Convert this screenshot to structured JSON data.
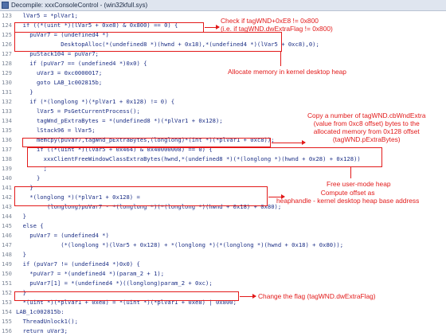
{
  "window": {
    "title": "Decompile: xxxConsoleControl - (win32kfull.sys)"
  },
  "code_lines": [
    {
      "n": "123",
      "text": "  lVar5 = *plVar1;"
    },
    {
      "n": "124",
      "text": "  if ((*(uint *)(lVar5 + 0xe8) & 0x800) == 0) {"
    },
    {
      "n": "125",
      "text": "    puVar7 = (undefined4 *)"
    },
    {
      "n": "126",
      "text": "             DesktopAlloc(*(undefined8 *)(hwnd + 0x18),*(undefined4 *)(lVar5 + 0xc8),0);"
    },
    {
      "n": "127",
      "text": "    puStack104 = puVar7;"
    },
    {
      "n": "128",
      "text": "    if (puVar7 == (undefined4 *)0x0) {"
    },
    {
      "n": "129",
      "text": "      uVar3 = 0xc0000017;"
    },
    {
      "n": "130",
      "text": "      goto LAB_1c002815b;"
    },
    {
      "n": "131",
      "text": "    }"
    },
    {
      "n": "132",
      "text": "    if (*(longlong *)(*plVar1 + 0x128) != 0) {"
    },
    {
      "n": "133",
      "text": "      lVar5 = PsGetCurrentProcess();"
    },
    {
      "n": "134",
      "text": "      tagWnd_pExtraBytes = *(undefined8 *)(*plVar1 + 0x128);"
    },
    {
      "n": "135",
      "text": "      lStack96 = lVar5;"
    },
    {
      "n": "136",
      "text": "      memcpy(puVar7,tagWnd_pExtraBytes,(longlong)*(int *)(*plVar1 + 0xc8));"
    },
    {
      "n": "137",
      "text": "      if ((*(uint *)(lVar5 + 0x464) & 0x40000008) == 0) {"
    },
    {
      "n": "138",
      "text": "        xxxClientFreeWindowClassExtraBytes(hwnd,*(undefined8 *)(*(longlong *)(hwnd + 0x28) + 0x128))"
    },
    {
      "n": "139",
      "text": "        ;"
    },
    {
      "n": "140",
      "text": "      }"
    },
    {
      "n": "141",
      "text": "    }"
    },
    {
      "n": "142",
      "text": "    *(longlong *)(*plVar1 + 0x128) ="
    },
    {
      "n": "143",
      "text": "         (longlong)puVar7 - *(longlong *)(*(longlong *)(hwnd + 0x18) + 0x80);"
    },
    {
      "n": "144",
      "text": "  }"
    },
    {
      "n": "145",
      "text": "  else {"
    },
    {
      "n": "146",
      "text": "    puVar7 = (undefined4 *)"
    },
    {
      "n": "147",
      "text": "             (*(longlong *)(lVar5 + 0x128) + *(longlong *)(*(longlong *)(hwnd + 0x18) + 0x80));"
    },
    {
      "n": "148",
      "text": "  }"
    },
    {
      "n": "149",
      "text": "  if (puVar7 != (undefined4 *)0x0) {"
    },
    {
      "n": "150",
      "text": "    *puVar7 = *(undefined4 *)(param_2 + 1);"
    },
    {
      "n": "151",
      "text": "    puVar7[1] = *(undefined4 *)((longlong)param_2 + 0xc);"
    },
    {
      "n": "152",
      "text": "  }"
    },
    {
      "n": "153",
      "text": "  *(uint *)(*plVar1 + 0xe8) = *(uint *)(*plVar1 + 0xe8) | 0x800;"
    },
    {
      "n": "154",
      "text": "LAB_1c002815b:"
    },
    {
      "n": "155",
      "text": "  ThreadUnlock1();"
    },
    {
      "n": "156",
      "text": "  return uVar3;"
    }
  ],
  "annotations": {
    "check_flag": "Check if tagWND+0xE8 != 0x800\n(i.e. if tagWND.dwExtraFlag != 0x800)",
    "allocate": "Allocate memory in kernel desktop heap",
    "copy": "Copy a number of tagWND.cbWndExtra\n(value from 0xc8 offset) bytes to the\nallocated memory from 0x128 offset\n(tagWND.pExtraBytes)",
    "free": "Free user-mode heap",
    "compute": "Compute offset as\nheaphandle - kernel desktop heap base address",
    "change_flag": "Change the flag (tagWND.dwExtraFlag)"
  },
  "colors": {
    "annotation": "#e21a1a",
    "code_text": "#1c2f86",
    "line_number": "#7d8797",
    "titlebar": "#dfe5ef"
  }
}
